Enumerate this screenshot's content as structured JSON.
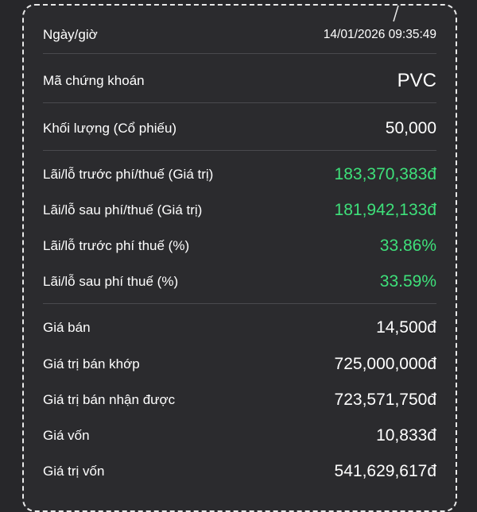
{
  "rows": {
    "datetime": {
      "label": "Ngày/giờ",
      "value": "14/01/2026 09:35:49"
    },
    "symbol": {
      "label": "Mã chứng khoán",
      "value": "PVC"
    },
    "volume": {
      "label": "Khối lượng (Cổ phiếu)",
      "value": "50,000"
    },
    "pl_before_value": {
      "label": "Lãi/lỗ trước phí/thuế (Giá trị)",
      "value": "183,370,383đ"
    },
    "pl_after_value": {
      "label": "Lãi/lỗ sau phí/thuế (Giá trị)",
      "value": "181,942,133đ"
    },
    "pl_before_pct": {
      "label": "Lãi/lỗ trước phí thuế (%)",
      "value": "33.86%"
    },
    "pl_after_pct": {
      "label": "Lãi/lỗ sau phí thuế (%)",
      "value": "33.59%"
    },
    "sell_price": {
      "label": "Giá bán",
      "value": "14,500đ"
    },
    "sell_matched_value": {
      "label": "Giá trị bán khớp",
      "value": "725,000,000đ"
    },
    "sell_received_value": {
      "label": "Giá trị bán nhận được",
      "value": "723,571,750đ"
    },
    "cost_price": {
      "label": "Giá vốn",
      "value": "10,833đ"
    },
    "cost_value": {
      "label": "Giá trị vốn",
      "value": "541,629,617đ"
    }
  },
  "colors": {
    "background": "#27272a",
    "card": "#2b2b2e",
    "profit": "#3ee07a",
    "text": "#ffffff",
    "divider": "#4a4a4e"
  }
}
